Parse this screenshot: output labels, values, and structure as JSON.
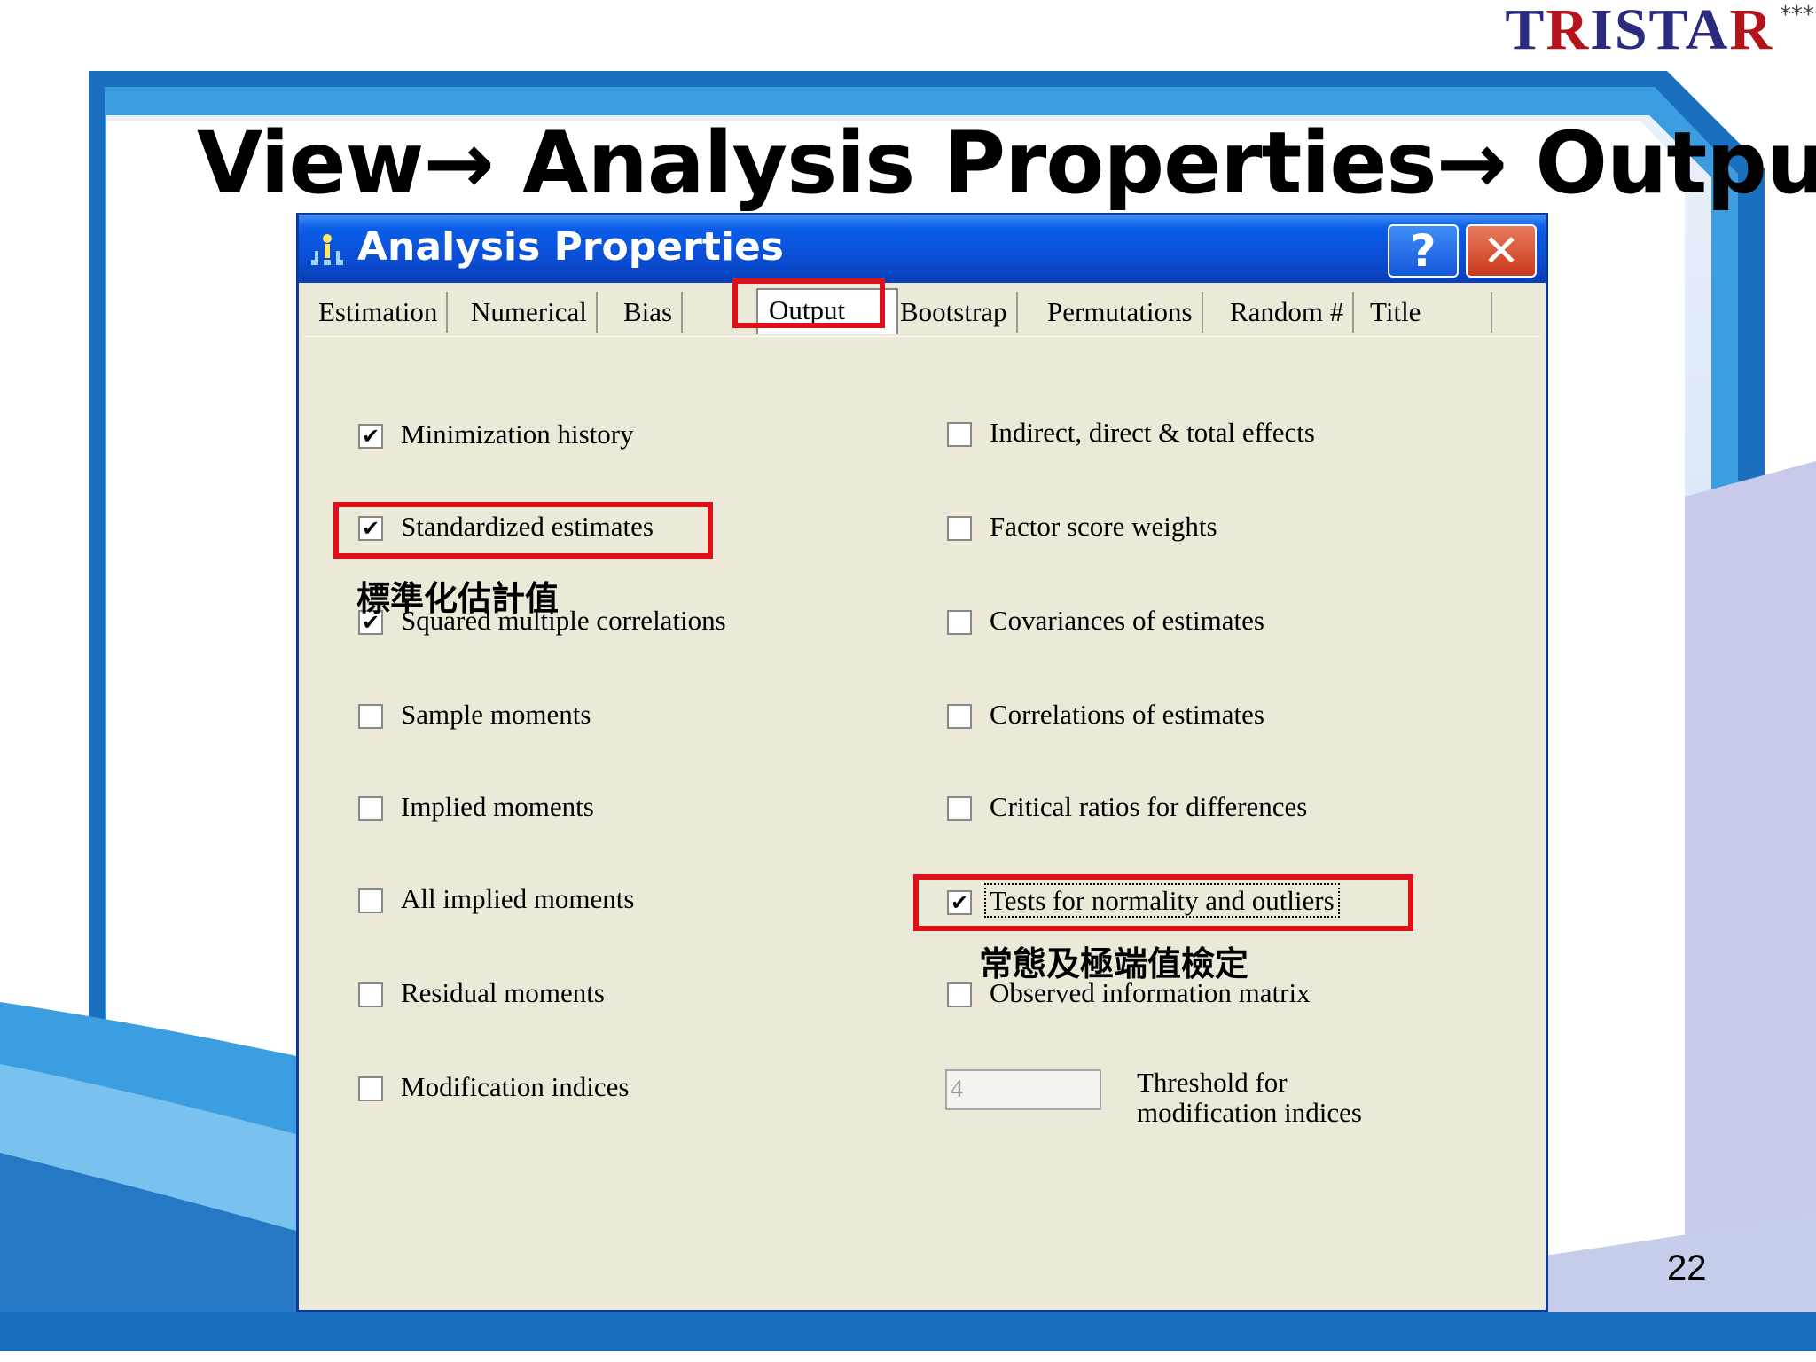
{
  "logo": {
    "text": "TRISTAR",
    "stars": "***"
  },
  "slide": {
    "title": "View→ Analysis Properties→ Output",
    "page_number": "22"
  },
  "dialog": {
    "title": "Analysis Properties",
    "help_label": "?",
    "close_label": "✕",
    "tabs": [
      {
        "label": "Estimation"
      },
      {
        "label": "Numerical"
      },
      {
        "label": "Bias"
      },
      {
        "label": "Output"
      },
      {
        "label": "Bootstrap"
      },
      {
        "label": "Permutations"
      },
      {
        "label": "Random #"
      },
      {
        "label": "Title"
      }
    ],
    "active_tab": "Output",
    "left_options": [
      {
        "label": "Minimization history",
        "checked": true
      },
      {
        "label": "Standardized estimates",
        "checked": true
      },
      {
        "label": "Squared multiple correlations",
        "checked": true
      },
      {
        "label": "Sample moments",
        "checked": false
      },
      {
        "label": "Implied moments",
        "checked": false
      },
      {
        "label": "All implied moments",
        "checked": false
      },
      {
        "label": "Residual moments",
        "checked": false
      },
      {
        "label": "Modification indices",
        "checked": false
      }
    ],
    "right_options": [
      {
        "label": "Indirect, direct & total effects",
        "checked": false
      },
      {
        "label": "Factor score weights",
        "checked": false
      },
      {
        "label": "Covariances of estimates",
        "checked": false
      },
      {
        "label": "Correlations of estimates",
        "checked": false
      },
      {
        "label": "Critical ratios for differences",
        "checked": false
      },
      {
        "label": "Tests for normality and outliers",
        "checked": true
      },
      {
        "label": "Observed information matrix",
        "checked": false
      }
    ],
    "threshold": {
      "value": "4",
      "label_line1": "Threshold for",
      "label_line2": "modification indices"
    }
  },
  "annotations": {
    "standardized_cn": "標準化估計值",
    "normality_cn": "常態及極端值檢定"
  },
  "colors": {
    "highlight": "#e0101a",
    "titlebar": "#0b5ee8",
    "dialog_bg": "#ece9d8"
  }
}
